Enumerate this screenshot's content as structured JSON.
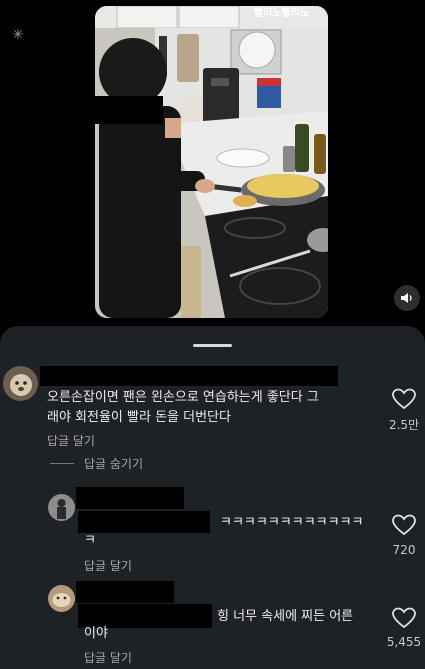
{
  "video": {
    "overlay_text": "빨리노빨리노"
  },
  "comments": [
    {
      "text_line1": "오른손잡이면 팬은 왼손으로 연습하는게 좋단다 그",
      "text_line2": "래야 회전율이 빨라 돈을 더번단다",
      "reply_label": "답글 달기",
      "like_count": "2.5만",
      "hide_replies_label": "답글 숨기기"
    },
    {
      "text_line1": "ㅋㅋㅋㅋㅋㅋㅋㅋㅋㅋㅋㅋ",
      "text_line2": "ㅋ",
      "reply_label": "답글 달기",
      "like_count": "720"
    },
    {
      "text_line1": "힝 너무 속세에 찌든 어른",
      "text_line2": "이야",
      "reply_label": "답글 달기",
      "like_count": "5,455"
    }
  ],
  "colors": {
    "panel_bg": "#1e2126",
    "text": "#eeeeee",
    "secondary_text": "#a8a8a8",
    "redaction": "#000000"
  }
}
